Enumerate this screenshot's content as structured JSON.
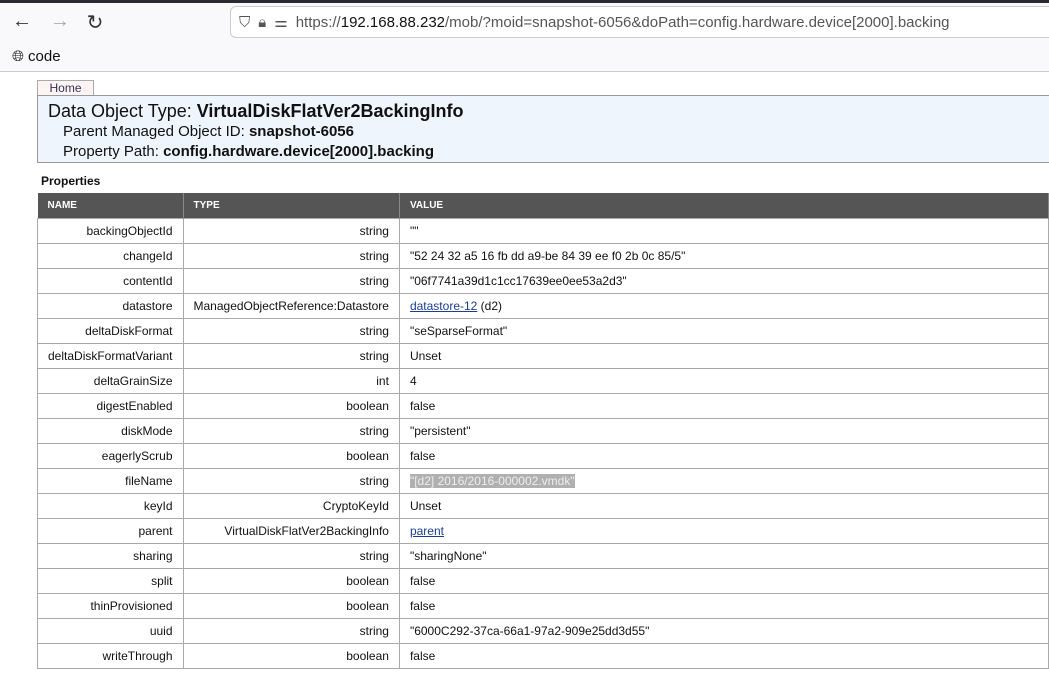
{
  "browser": {
    "url_prefix": "https://",
    "url_host": "192.168.88.232",
    "url_rest": "/mob/?moid=snapshot-6056&doPath=config.hardware.device[2000].backing",
    "bookmark": "code"
  },
  "home_tab": "Home",
  "header": {
    "type_label": "Data Object Type: ",
    "type_value": "VirtualDiskFlatVer2BackingInfo",
    "parent_label": "Parent Managed Object ID: ",
    "parent_value": "snapshot-6056",
    "path_label": "Property Path: ",
    "path_value": "config.hardware.device[2000].backing"
  },
  "properties_label": "Properties",
  "columns": [
    "NAME",
    "TYPE",
    "VALUE"
  ],
  "rows": [
    {
      "name": "backingObjectId",
      "type": "string",
      "value": "\"\""
    },
    {
      "name": "changeId",
      "type": "string",
      "value": "\"52 24 32 a5 16 fb dd a9-be 84 39 ee f0 2b 0c 85/5\""
    },
    {
      "name": "contentId",
      "type": "string",
      "value": "\"06f7741a39d1c1cc17639ee0ee53a2d3\""
    },
    {
      "name": "datastore",
      "type": "ManagedObjectReference:Datastore",
      "link": "datastore-12",
      "value": " (d2)"
    },
    {
      "name": "deltaDiskFormat",
      "type": "string",
      "value": "\"seSparseFormat\""
    },
    {
      "name": "deltaDiskFormatVariant",
      "type": "string",
      "value": "Unset"
    },
    {
      "name": "deltaGrainSize",
      "type": "int",
      "value": "4"
    },
    {
      "name": "digestEnabled",
      "type": "boolean",
      "value": "false"
    },
    {
      "name": "diskMode",
      "type": "string",
      "value": "\"persistent\""
    },
    {
      "name": "eagerlyScrub",
      "type": "boolean",
      "value": "false"
    },
    {
      "name": "fileName",
      "type": "string",
      "value": "\"[d2] 2016/2016-000002.vmdk\"",
      "selected": true
    },
    {
      "name": "keyId",
      "type": "CryptoKeyId",
      "value": "Unset"
    },
    {
      "name": "parent",
      "type": "VirtualDiskFlatVer2BackingInfo",
      "link": "parent",
      "value": ""
    },
    {
      "name": "sharing",
      "type": "string",
      "value": "\"sharingNone\""
    },
    {
      "name": "split",
      "type": "boolean",
      "value": "false"
    },
    {
      "name": "thinProvisioned",
      "type": "boolean",
      "value": "false"
    },
    {
      "name": "uuid",
      "type": "string",
      "value": "\"6000C292-37ca-66a1-97a2-909e25dd3d55\""
    },
    {
      "name": "writeThrough",
      "type": "boolean",
      "value": "false"
    }
  ]
}
